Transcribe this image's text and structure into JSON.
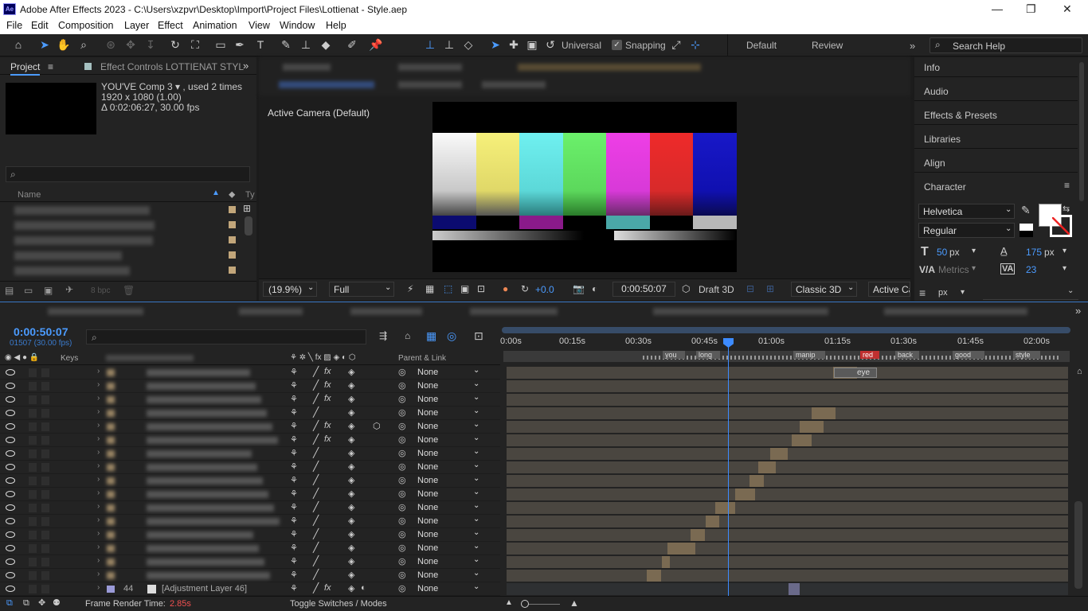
{
  "window": {
    "title": "Adobe After Effects 2023 - C:\\Users\\xzpvr\\Desktop\\Import\\Project Files\\Lottienat - Style.aep",
    "logo": "Ae"
  },
  "menu": [
    "File",
    "Edit",
    "Composition",
    "Layer",
    "Effect",
    "Animation",
    "View",
    "Window",
    "Help"
  ],
  "toolbar": {
    "universal": "Universal",
    "snapping": "Snapping",
    "workspace_default": "Default",
    "workspace_review": "Review",
    "search_placeholder": "Search Help"
  },
  "project": {
    "tab": "Project",
    "effect_tab": "Effect Controls LOTTIENAT STYL",
    "comp_name": "YOU'VE Comp 3 ▾ , used 2 times",
    "resolution": "1920 x 1080 (1.00)",
    "duration": "Δ 0:02:06:27, 30.00 fps",
    "col_name": "Name",
    "col_type": "Ty",
    "bpc": "8 bpc"
  },
  "viewer": {
    "label": "Active Camera (Default)",
    "zoom": "(19.9%)",
    "quality": "Full",
    "exposure": "+0.0",
    "timecode": "0:00:50:07",
    "draft": "Draft 3D",
    "renderer": "Classic 3D",
    "camera": "Active Ca"
  },
  "right_panel": {
    "items": [
      "Info",
      "Audio",
      "Effects & Presets",
      "Libraries",
      "Align",
      "Character"
    ],
    "font": "Helvetica",
    "style": "Regular",
    "size": "50",
    "size_unit": "px",
    "leading": "175",
    "leading_unit": "px",
    "kerning": "Metrics",
    "tracking": "23",
    "px": "px"
  },
  "timeline": {
    "timecode": "0:00:50:07",
    "frames": "01507 (30.00 fps)",
    "keys_header": "Keys",
    "parent_header": "Parent & Link",
    "ruler": [
      "0:00s",
      "00:15s",
      "00:30s",
      "00:45s",
      "01:00s",
      "01:15s",
      "01:30s",
      "01:45s",
      "02:00s"
    ],
    "markers": [
      "you",
      "long",
      "manip",
      "red",
      "back",
      "good",
      "style"
    ],
    "eye_label": "eye",
    "layer_number": "44",
    "layer_name": "[Adjustment Layer 46]",
    "parent_value": "None",
    "render_label": "Frame Render Time:",
    "render_time": "2.85s",
    "toggle_label": "Toggle Switches / Modes"
  },
  "colors": {
    "accent": "#4b9bff",
    "bar": "#7a6a52",
    "track": "#4a4640"
  }
}
